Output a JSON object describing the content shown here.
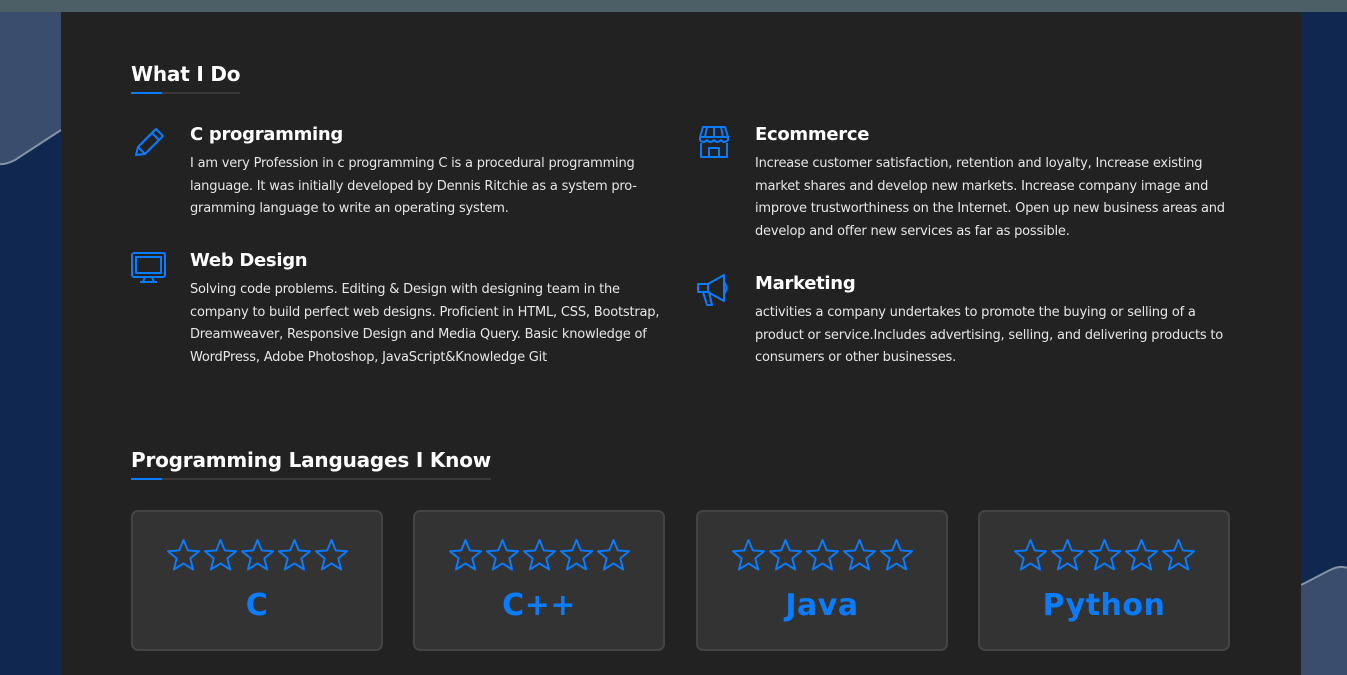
{
  "what_i_do": {
    "title": "What I Do",
    "services": [
      {
        "icon": "pencil-icon",
        "title": "C programming",
        "desc": "I am very Profession in c programming C is a procedural programming language. It was initially developed by Dennis Ritchie as a system pro-gramming language to write an operating system."
      },
      {
        "icon": "store-icon",
        "title": "Ecommerce",
        "desc": "Increase customer satisfaction, retention and loyalty, Increase existing market shares and develop new markets. Increase company image and improve trustworthiness on the Internet. Open up new business areas and develop and offer new services as far as possible."
      },
      {
        "icon": "monitor-icon",
        "title": "Web Design",
        "desc": "Solving code problems. Editing & Design with designing team in the company to build perfect web designs. Proficient in HTML, CSS, Bootstrap, Dreamweaver, Responsive Design and Media Query. Basic knowledge of WordPress, Adobe Photoshop, JavaScript&Knowledge Git"
      },
      {
        "icon": "megaphone-icon",
        "title": "Marketing",
        "desc": "activities a company undertakes to promote the buying or selling of a product or service.Includes advertising, selling, and delivering products to consumers or other businesses."
      }
    ]
  },
  "languages": {
    "title": "Programming Languages I Know",
    "items": [
      {
        "name": "C",
        "rating": 0,
        "max_rating": 5
      },
      {
        "name": "C++",
        "rating": 0,
        "max_rating": 5
      },
      {
        "name": "Java",
        "rating": 0,
        "max_rating": 5
      },
      {
        "name": "Python",
        "rating": 0,
        "max_rating": 5
      }
    ]
  },
  "colors": {
    "accent": "#0a7cff",
    "card_bg": "#222222",
    "page_bg": "#10284f",
    "tile_bg": "#333333"
  }
}
